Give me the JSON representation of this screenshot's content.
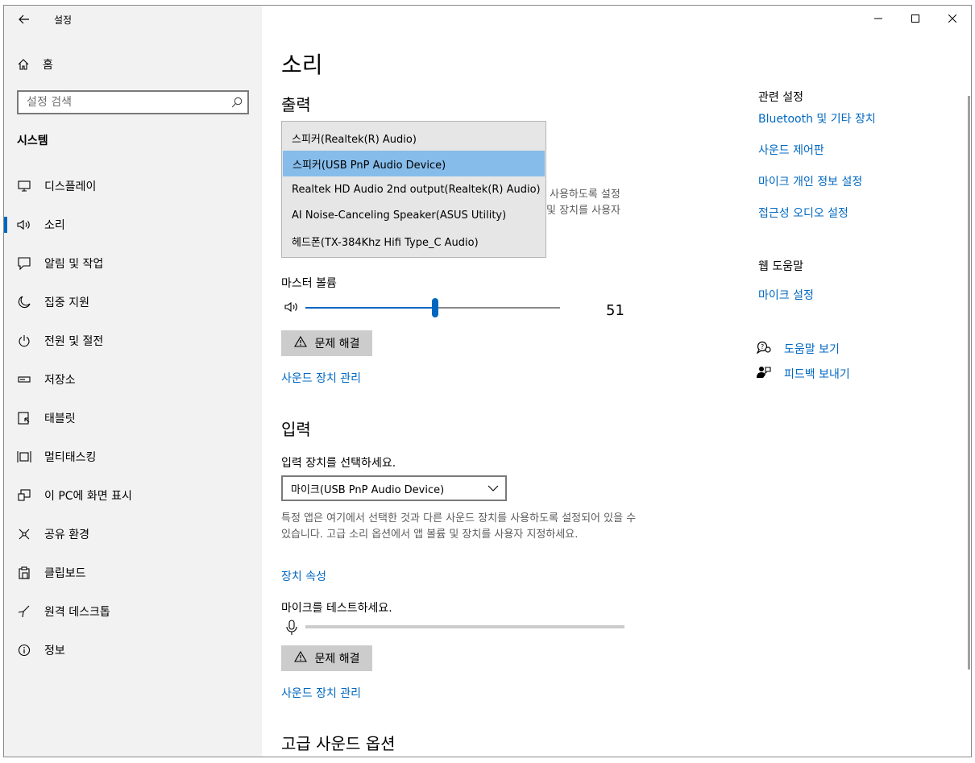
{
  "window": {
    "app_title": "설정",
    "controls": [
      "minimize",
      "maximize",
      "close"
    ]
  },
  "sidebar": {
    "home_label": "홈",
    "search_placeholder": "설정 검색",
    "section_title": "시스템",
    "items": [
      {
        "label": "디스플레이",
        "icon": "monitor-icon",
        "active": false
      },
      {
        "label": "소리",
        "icon": "speaker-icon",
        "active": true
      },
      {
        "label": "알림 및 작업",
        "icon": "notification-icon",
        "active": false
      },
      {
        "label": "집중 지원",
        "icon": "moon-icon",
        "active": false
      },
      {
        "label": "전원 및 절전",
        "icon": "power-icon",
        "active": false
      },
      {
        "label": "저장소",
        "icon": "storage-icon",
        "active": false
      },
      {
        "label": "태블릿",
        "icon": "tablet-icon",
        "active": false
      },
      {
        "label": "멀티태스킹",
        "icon": "multitasking-icon",
        "active": false
      },
      {
        "label": "이 PC에 화면 표시",
        "icon": "project-icon",
        "active": false
      },
      {
        "label": "공유 환경",
        "icon": "share-icon",
        "active": false
      },
      {
        "label": "클립보드",
        "icon": "clipboard-icon",
        "active": false
      },
      {
        "label": "원격 데스크톱",
        "icon": "remote-desktop-icon",
        "active": false
      },
      {
        "label": "정보",
        "icon": "info-icon",
        "active": false
      }
    ]
  },
  "main": {
    "title": "소리",
    "output": {
      "heading": "출력",
      "dropdown_options": [
        "스피커(Realtek(R) Audio)",
        "스피커(USB PnP Audio Device)",
        "Realtek HD Audio 2nd output(Realtek(R) Audio)",
        "AI Noise-Canceling Speaker(ASUS Utility)",
        "헤드폰(TX-384Khz Hifi Type_C Audio)"
      ],
      "selected_index": 1,
      "hidden_help_line1": "사용하도록 설정",
      "hidden_help_line2": "및 장치를 사용자",
      "master_volume_label": "마스터 볼륨",
      "volume_value": "51",
      "volume_level": 51,
      "troubleshoot_label": "문제 해결",
      "manage_link": "사운드 장치 관리"
    },
    "input": {
      "heading": "입력",
      "select_label": "입력 장치를 선택하세요.",
      "selected_device": "마이크(USB PnP Audio Device)",
      "help_text": "특정 앱은 여기에서 선택한 것과 다른 사운드 장치를 사용하도록 설정되어 있을 수 있습니다. 고급 소리 옵션에서 앱 볼륨 및 장치를 사용자 지정하세요.",
      "properties_link": "장치 속성",
      "test_label": "마이크를 테스트하세요.",
      "mic_level": 0,
      "troubleshoot_label": "문제 해결",
      "manage_link": "사운드 장치 관리"
    },
    "advanced_heading": "고급 사운드 옵션"
  },
  "related": {
    "heading": "관련 설정",
    "links": [
      "Bluetooth 및 기타 장치",
      "사운드 제어판",
      "마이크 개인 정보 설정",
      "접근성 오디오 설정"
    ],
    "web_help_heading": "웹 도움말",
    "web_help_link": "마이크 설정",
    "help_link": "도움말 보기",
    "feedback_link": "피드백 보내기"
  },
  "colors": {
    "accent": "#0067c0",
    "selected_option_bg": "#86bcea",
    "sidebar_bg": "#f2f2f2",
    "button_bg": "#cccccc"
  }
}
